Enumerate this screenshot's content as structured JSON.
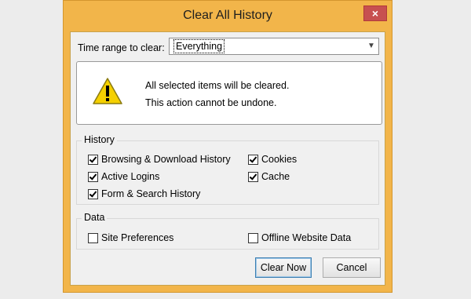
{
  "colors": {
    "page_bg": "#ececec",
    "title_bar": "#f2b54a",
    "close_button": "#c75050"
  },
  "window": {
    "title": "Clear All History",
    "close_icon": "×"
  },
  "range": {
    "label": "Time range to clear:",
    "selected": "Everything",
    "dropdown_icon": "chevron-down-icon"
  },
  "warning": {
    "icon": "warning-icon",
    "line1": "All selected items will be cleared.",
    "line2": "This action cannot be undone."
  },
  "history": {
    "title": "History",
    "items": [
      {
        "label": "Browsing & Download History",
        "checked": true
      },
      {
        "label": "Cookies",
        "checked": true
      },
      {
        "label": "Active Logins",
        "checked": true
      },
      {
        "label": "Cache",
        "checked": true
      },
      {
        "label": "Form & Search History",
        "checked": true
      }
    ]
  },
  "data_section": {
    "title": "Data",
    "items": [
      {
        "label": "Site Preferences",
        "checked": false
      },
      {
        "label": "Offline Website Data",
        "checked": false
      }
    ]
  },
  "buttons": {
    "clear_now": "Clear Now",
    "cancel": "Cancel"
  }
}
